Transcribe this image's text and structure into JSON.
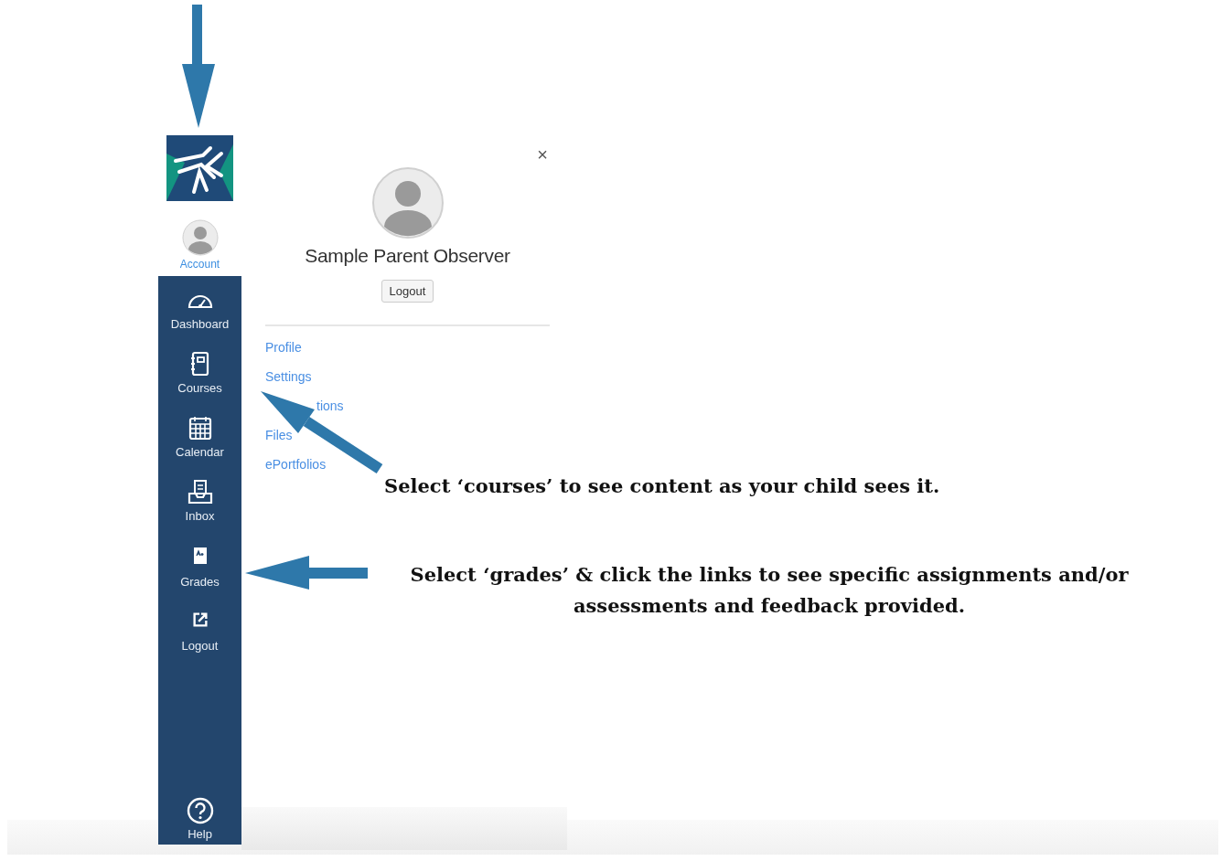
{
  "sidebar": {
    "account": {
      "label": "Account",
      "selected": true
    },
    "items": [
      {
        "label": "Dashboard",
        "kind": "dashboard",
        "selected": false
      },
      {
        "label": "Courses",
        "kind": "courses",
        "selected": false
      },
      {
        "label": "Calendar",
        "kind": "calendar",
        "selected": false
      },
      {
        "label": "Inbox",
        "kind": "inbox",
        "selected": false
      },
      {
        "label": "Grades",
        "kind": "grades",
        "selected": false
      },
      {
        "label": "Logout",
        "kind": "logout",
        "selected": false
      }
    ],
    "help": {
      "label": "Help"
    }
  },
  "account_panel": {
    "close": "×",
    "name": "Sample Parent Observer",
    "logout_button": "Logout",
    "links": [
      "Profile",
      "Settings",
      "tions",
      "Files",
      "ePortfolios"
    ]
  },
  "callouts": [
    "Select ‘courses’ to see content as your child sees it.",
    "Select ‘grades’ & click the links to see specific assignments and/or assessments and feedback provided."
  ]
}
